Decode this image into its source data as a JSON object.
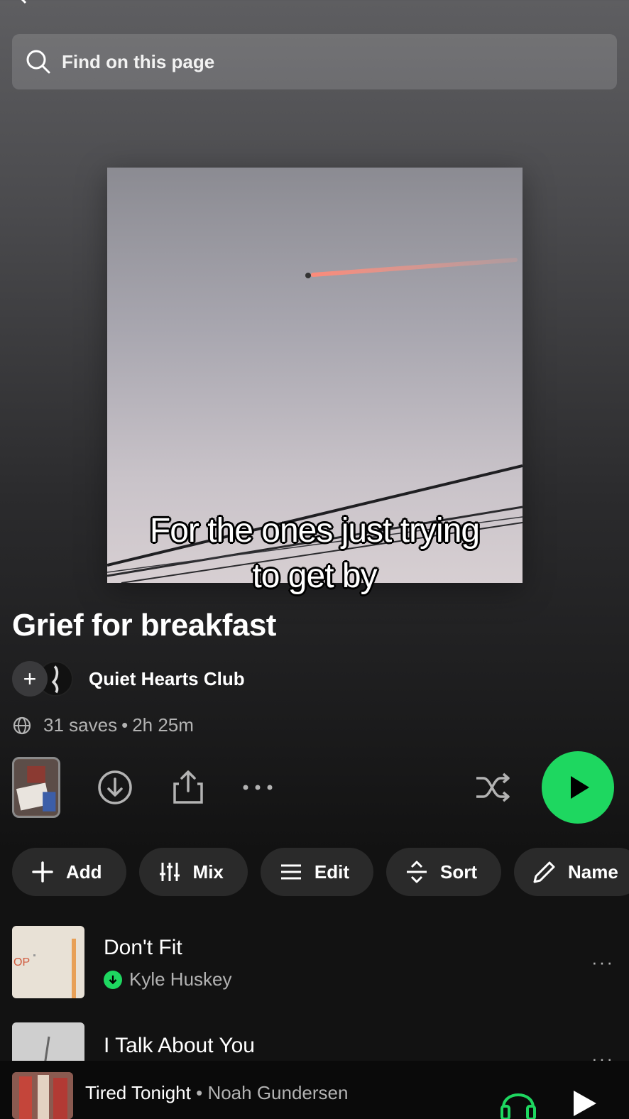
{
  "search": {
    "placeholder": "Find on this page",
    "icon": "search-icon"
  },
  "caption": {
    "line1": "For the ones just trying",
    "line2": "to get by"
  },
  "playlist": {
    "title": "Grief for breakfast",
    "owner": "Quiet Hearts Club",
    "saves": "31 saves",
    "duration": "2h 25m",
    "separator": "•"
  },
  "controls": {
    "icons": [
      "download-icon",
      "share-icon",
      "more-icon",
      "shuffle-icon",
      "play-icon"
    ],
    "more_label": "···"
  },
  "chips": [
    {
      "label": "Add",
      "icon": "plus-icon"
    },
    {
      "label": "Mix",
      "icon": "mix-icon"
    },
    {
      "label": "Edit",
      "icon": "list-icon"
    },
    {
      "label": "Sort",
      "icon": "sort-icon"
    },
    {
      "label": "Name",
      "icon": "pencil-icon"
    }
  ],
  "tracks": [
    {
      "title": "Don't Fit",
      "artist": "Kyle Huskey",
      "downloaded": true
    },
    {
      "title": "I Talk About You",
      "artist": "",
      "downloaded": false
    }
  ],
  "now_playing": {
    "song": "Tired Tonight",
    "artist": "Noah Gundersen",
    "separator": " • "
  },
  "colors": {
    "accent": "#1ed760",
    "chip_bg": "#2a2a2a",
    "background": "#121212",
    "secondary_text": "#b3b3b3"
  }
}
